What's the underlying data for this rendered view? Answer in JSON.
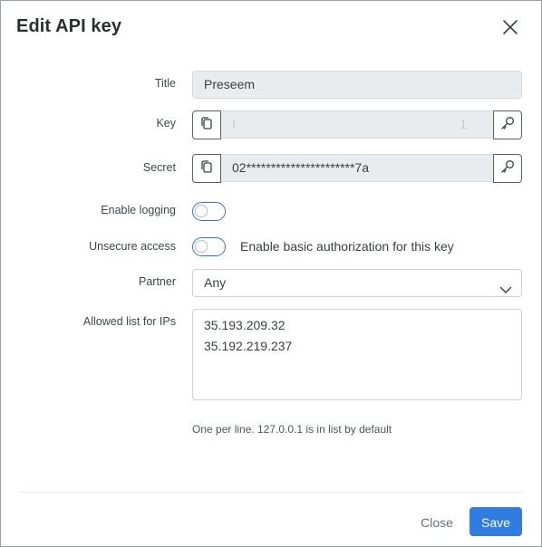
{
  "dialog": {
    "title": "Edit API key"
  },
  "form": {
    "title_label": "Title",
    "title_value": "Preseem",
    "key_label": "Key",
    "key_value_start": "I",
    "key_value_end": "1",
    "secret_label": "Secret",
    "secret_value": "02**********************7a",
    "logging_label": "Enable logging",
    "logging_enabled": false,
    "unsecure_label": "Unsecure access",
    "unsecure_enabled": false,
    "unsecure_text": "Enable basic authorization for this key",
    "partner_label": "Partner",
    "partner_value": "Any",
    "ips_label": "Allowed list for IPs",
    "ips": [
      "35.193.209.32",
      "35.192.219.237"
    ],
    "ips_help": "One per line. 127.0.0.1 is in list by default"
  },
  "footer": {
    "close_label": "Close",
    "save_label": "Save"
  },
  "colors": {
    "primary": "#2f7de1",
    "toggle_border": "#2f75d6"
  },
  "icons": {
    "close": "close-icon",
    "copy": "copy-icon",
    "key": "key-icon",
    "chevron": "chevron-down-icon"
  }
}
